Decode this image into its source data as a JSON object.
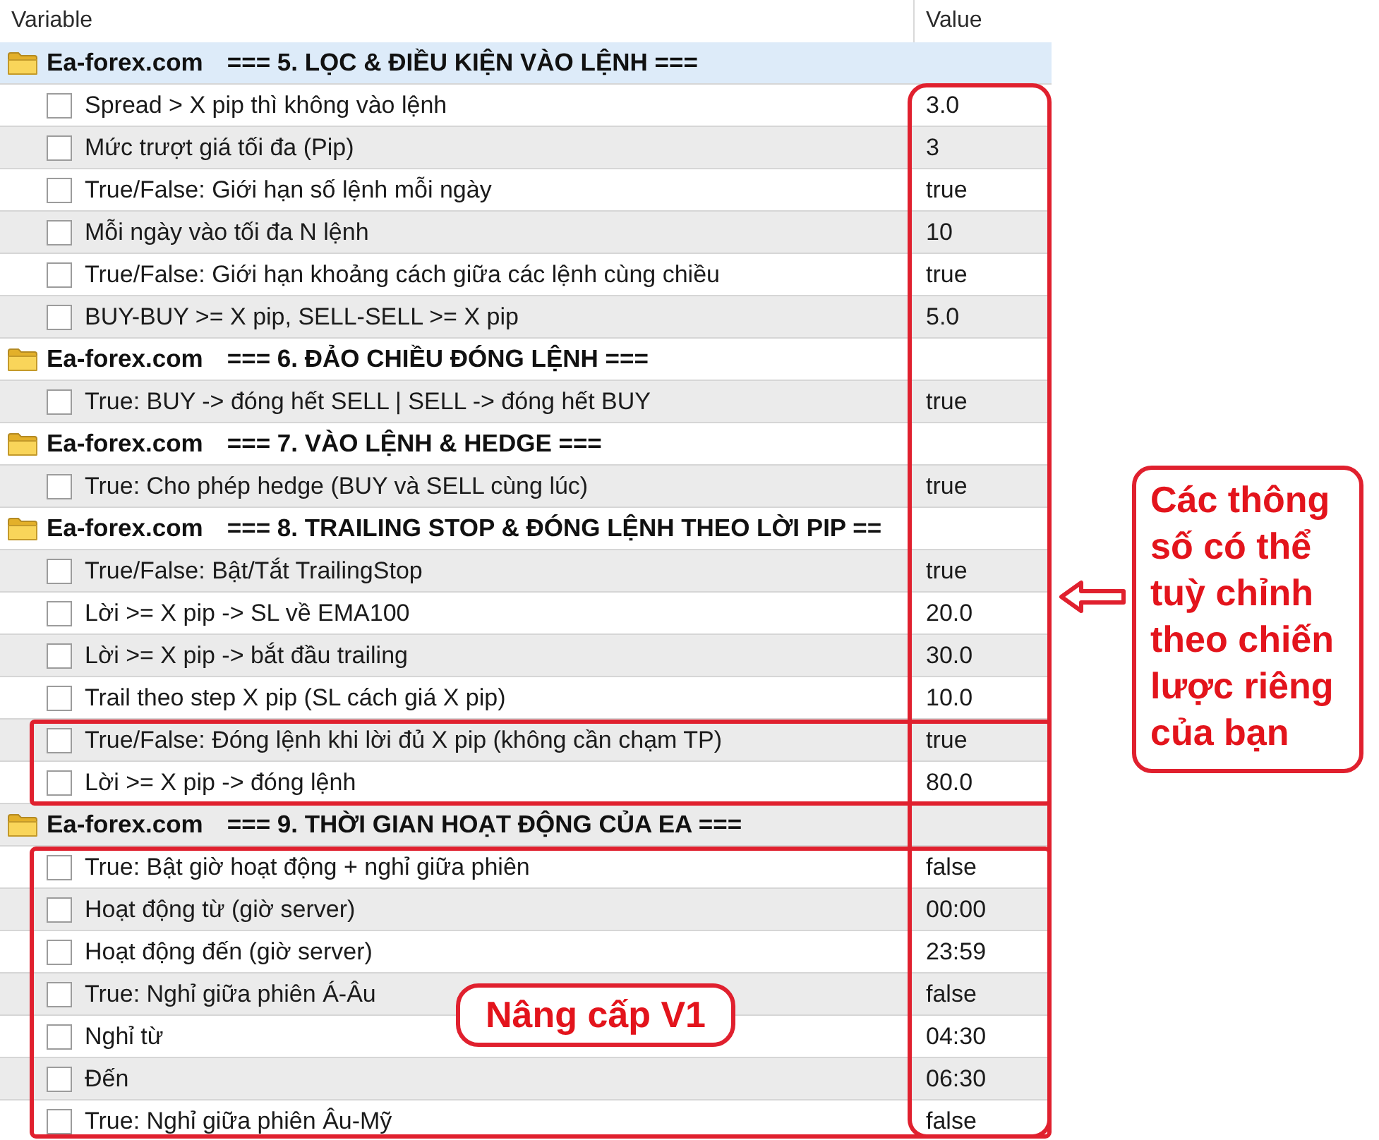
{
  "table": {
    "columns": [
      "Variable",
      "Value"
    ],
    "groups": [
      {
        "label": "Ea-forex.com",
        "title": "=== 5. LỌC & ĐIỀU KIỆN VÀO LỆNH ===",
        "selected": true,
        "children": [
          {
            "name": "Spread > X pip thì không vào lệnh",
            "value": "3.0",
            "checked": false,
            "selected": false
          },
          {
            "name": "Mức trượt giá tối đa (Pip)",
            "value": "3",
            "checked": false,
            "selected": false
          },
          {
            "name": "True/False: Giới hạn số lệnh mỗi ngày",
            "value": "true",
            "checked": false,
            "selected": false
          },
          {
            "name": "Mỗi ngày vào tối đa N lệnh",
            "value": "10",
            "checked": false,
            "selected": false
          },
          {
            "name": "True/False: Giới hạn khoảng cách giữa các lệnh cùng chiều",
            "value": "true",
            "checked": false,
            "selected": false
          },
          {
            "name": "BUY-BUY >= X pip, SELL-SELL >= X pip",
            "value": "5.0",
            "checked": false,
            "selected": false
          }
        ]
      },
      {
        "label": "Ea-forex.com",
        "title": "=== 6. ĐẢO CHIỀU ĐÓNG LỆNH ===",
        "selected": false,
        "children": [
          {
            "name": "True: BUY -> đóng hết SELL | SELL -> đóng hết BUY",
            "value": "true",
            "checked": false,
            "selected": false
          }
        ]
      },
      {
        "label": "Ea-forex.com",
        "title": "=== 7. VÀO LỆNH & HEDGE ===",
        "selected": false,
        "children": [
          {
            "name": "True: Cho phép hedge (BUY và SELL cùng lúc)",
            "value": "true",
            "checked": false,
            "selected": false
          }
        ]
      },
      {
        "label": "Ea-forex.com",
        "title": "=== 8. TRAILING STOP & ĐÓNG LỆNH THEO LỜI PIP ==",
        "selected": false,
        "children": [
          {
            "name": "True/False: Bật/Tắt TrailingStop",
            "value": "true",
            "checked": false,
            "selected": false
          },
          {
            "name": "Lời >= X pip -> SL về EMA100",
            "value": "20.0",
            "checked": false,
            "selected": false
          },
          {
            "name": "Lời >= X pip -> bắt đầu trailing",
            "value": "30.0",
            "checked": false,
            "selected": false
          },
          {
            "name": "Trail theo step X pip (SL cách giá X pip)",
            "value": "10.0",
            "checked": false,
            "selected": false
          },
          {
            "name": "True/False: Đóng lệnh khi lời đủ X pip (không cần chạm TP)",
            "value": "true",
            "checked": false,
            "selected": false
          },
          {
            "name": "Lời >= X pip -> đóng lệnh",
            "value": "80.0",
            "checked": false,
            "selected": false
          }
        ]
      },
      {
        "label": "Ea-forex.com",
        "title": "=== 9. THỜI GIAN HOẠT ĐỘNG CỦA EA ===",
        "selected": false,
        "children": [
          {
            "name": "True: Bật giờ hoạt động + nghỉ giữa phiên",
            "value": "false",
            "checked": false,
            "selected": false
          },
          {
            "name": "Hoạt động từ (giờ server)",
            "value": "00:00",
            "checked": false,
            "selected": false
          },
          {
            "name": "Hoạt động đến (giờ server)",
            "value": "23:59",
            "checked": false,
            "selected": false
          },
          {
            "name": "True: Nghỉ giữa phiên Á-Âu",
            "value": "false",
            "checked": false,
            "selected": false
          },
          {
            "name": "Nghỉ từ",
            "value": "04:30",
            "checked": false,
            "selected": false
          },
          {
            "name": "Đến",
            "value": "06:30",
            "checked": false,
            "selected": false
          },
          {
            "name": "True: Nghỉ giữa phiên Âu-Mỹ",
            "value": "false",
            "checked": false,
            "selected": false
          }
        ]
      }
    ]
  },
  "annotations": {
    "callout": "Các thông số có thể tuỳ chỉnh theo chiến lược riêng của bạn",
    "badge": "Nâng cấp V1"
  }
}
